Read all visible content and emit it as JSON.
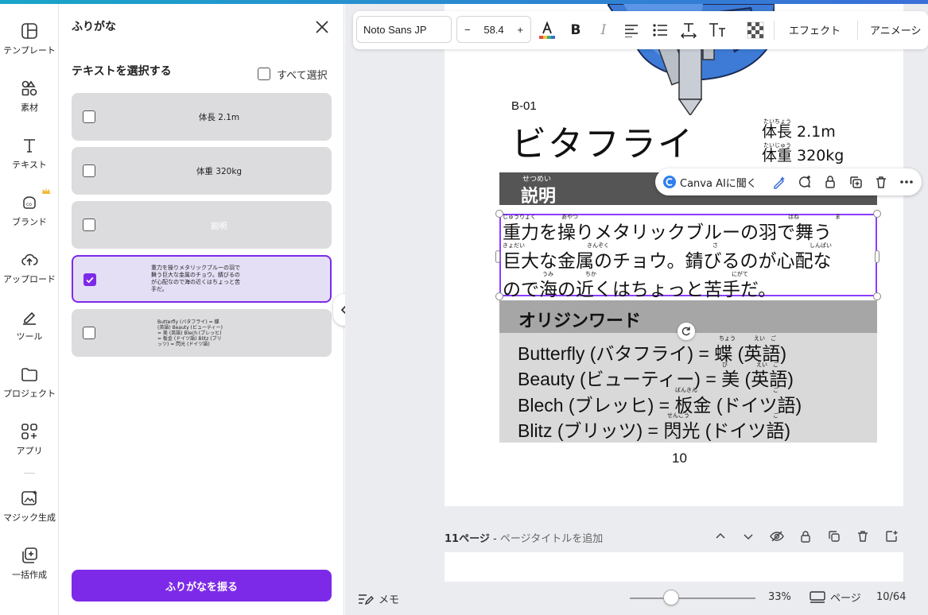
{
  "rail": {
    "items": [
      {
        "label": "テンプレート"
      },
      {
        "label": "素材"
      },
      {
        "label": "テキスト"
      },
      {
        "label": "ブランド"
      },
      {
        "label": "アップロード"
      },
      {
        "label": "ツール"
      },
      {
        "label": "プロジェクト"
      },
      {
        "label": "アプリ"
      },
      {
        "label": "マジック生成"
      },
      {
        "label": "一括作成"
      }
    ]
  },
  "panel": {
    "title": "ふりがな",
    "select_label": "テキストを選択する",
    "select_all": "すべて選択",
    "items": [
      {
        "text": "体長 2.1m",
        "checked": false
      },
      {
        "text": "体重 320kg",
        "checked": false
      },
      {
        "text": "説明",
        "checked": false
      },
      {
        "text": "重力を操りメタリックブルーの羽で舞う巨大な金属のチョウ。錆びるのが心配なので海の近くはちょっと苦手だ。",
        "checked": true
      },
      {
        "text": "Butterfly (バタフライ) = 蝶 (英語) Beauty (ビューティー) = 美 (英語) Blech (ブレッヒ) = 板金 (ドイツ語) Blitz (ブリッツ) = 閃光 (ドイツ語)",
        "checked": false
      }
    ],
    "apply_button": "ふりがなを振る"
  },
  "toolbar": {
    "font": "Noto Sans JP",
    "size_minus": "−",
    "size": "58.4",
    "size_plus": "+",
    "bold": "B",
    "italic": "I",
    "effect": "エフェクト",
    "animation": "アニメーシ"
  },
  "ai_bar": {
    "label": "Canva AIに聞く"
  },
  "page": {
    "code": "B-01",
    "name": "ビタフライ",
    "length": "体長 2.1m",
    "weight": "体重 320kg",
    "length_ruby": "たいちょう",
    "weight_ruby": "たいじゅう",
    "desc_heading": "説明",
    "desc_heading_ruby": "せつめい",
    "desc_line1": "重力を操りメタリックブルーの羽で舞う",
    "desc_line2": "巨大な金属のチョウ。錆びるのが心配な",
    "desc_line3": "ので海の近くはちょっと苦手だ。",
    "desc_ruby": {
      "r1": "じゅうりょく",
      "r2": "あやつ",
      "r3": "はね",
      "r4": "ま",
      "r5": "きょだい",
      "r6": "きんぞく",
      "r7": "さ",
      "r8": "しんぱい",
      "r9": "うみ",
      "r10": "ちか",
      "r11": "にがて"
    },
    "origin_heading": "オリジンワード",
    "origin_lines": [
      "Butterfly (バタフライ) = 蝶 (英語)",
      "Beauty (ビューティー) = 美 (英語)",
      "Blech (ブレッヒ) = 板金 (ドイツ語)",
      "Blitz (ブリッツ) = 閃光 (ドイツ語)"
    ],
    "origin_ruby": {
      "o1a": "ちょう",
      "o1b": "えい　ご",
      "o2a": "び",
      "o2b": "えい　ご",
      "o3a": "ばんきん",
      "o3b": "ご",
      "o4a": "せんこう",
      "o4b": "ご"
    },
    "number": "10"
  },
  "next_page": {
    "label": "11ページ",
    "dash": " - ",
    "hint": "ページタイトルを追加"
  },
  "bottom": {
    "memo": "メモ",
    "zoom": "33%",
    "zoom_level": 0.33,
    "page_button": "ページ",
    "page_count": "10/64"
  },
  "colors": {
    "accent": "#7d2ae8",
    "selection_border": "#8b3dff",
    "desc_header_bg": "#555555",
    "origin_header_bg": "#a6a6a6",
    "origin_body_bg": "#d9d9d9",
    "workspace_bg": "#ebecf0"
  }
}
